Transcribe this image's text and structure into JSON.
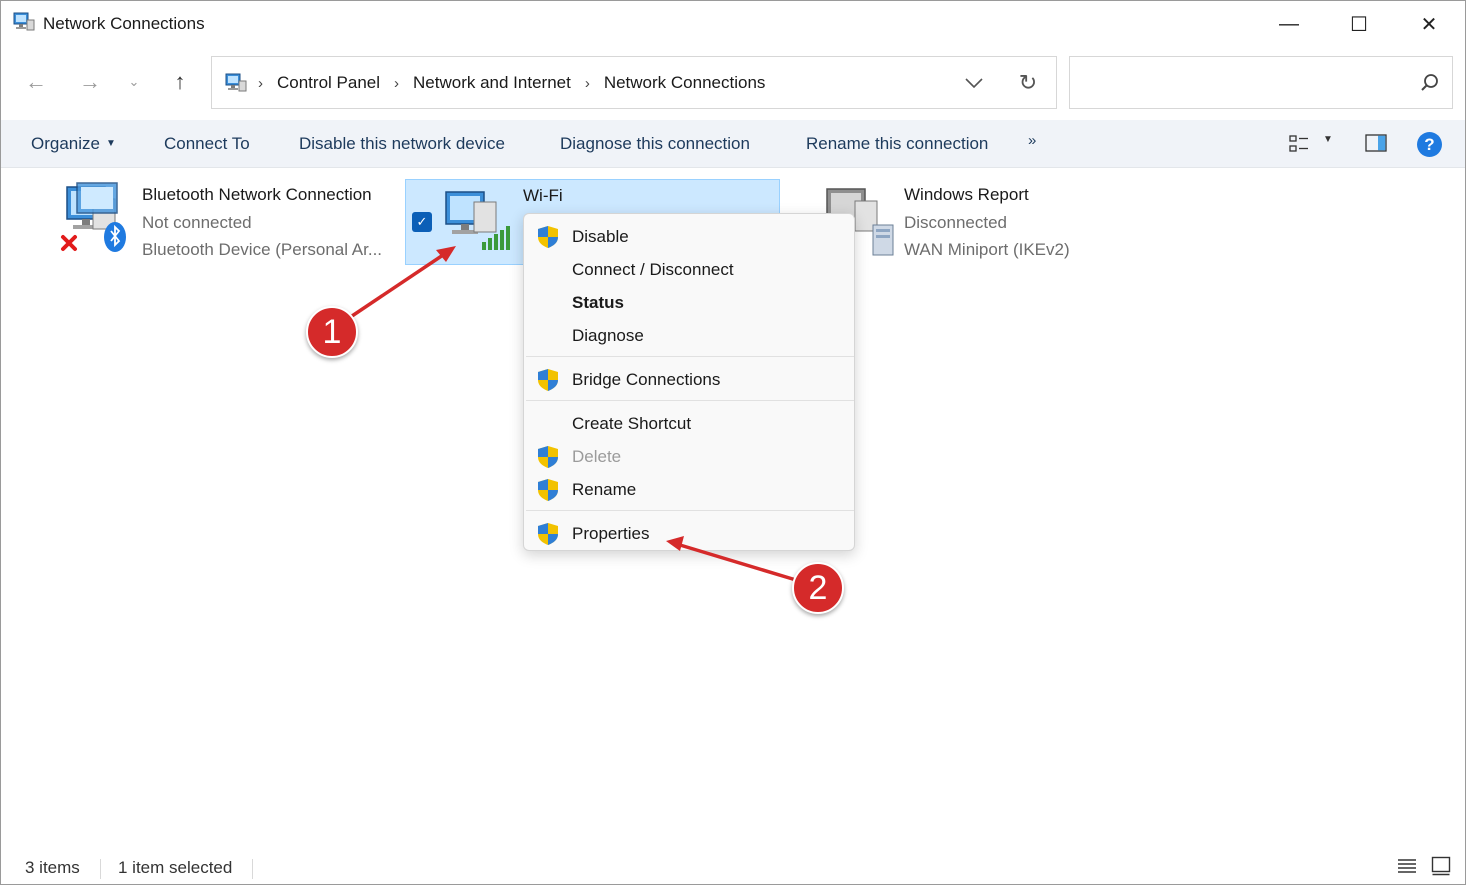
{
  "window": {
    "title": "Network Connections",
    "minimize": "—",
    "maximize": "☐",
    "close": "✕"
  },
  "nav": {
    "back": "←",
    "forward": "→",
    "recent": "⌄",
    "up": "↑"
  },
  "address": {
    "sep": "›",
    "crumbs": [
      "Control Panel",
      "Network and Internet",
      "Network Connections"
    ],
    "dropdown": "⌄",
    "refresh": "↻"
  },
  "search": {
    "placeholder": "",
    "value": ""
  },
  "commands": {
    "organize": "Organize",
    "connect_to": "Connect To",
    "disable": "Disable this network device",
    "diagnose": "Diagnose this connection",
    "rename": "Rename this connection",
    "more": "»",
    "help": "?"
  },
  "items": [
    {
      "name": "Bluetooth Network Connection",
      "status": "Not connected",
      "device": "Bluetooth Device (Personal Ar...",
      "icon": "bluetooth-network-icon",
      "selected": false
    },
    {
      "name": "Wi-Fi",
      "status": "",
      "device": "",
      "icon": "wifi-network-icon",
      "selected": true
    },
    {
      "name": "Windows Report",
      "status": "Disconnected",
      "device": "WAN Miniport (IKEv2)",
      "icon": "wan-network-icon",
      "selected": false
    }
  ],
  "context_menu": {
    "items": [
      {
        "label": "Disable",
        "shield": true
      },
      {
        "label": "Connect / Disconnect",
        "shield": false
      },
      {
        "label": "Status",
        "shield": false,
        "bold": true
      },
      {
        "label": "Diagnose",
        "shield": false
      },
      {
        "label": "Bridge Connections",
        "shield": true
      },
      {
        "label": "Create Shortcut",
        "shield": false
      },
      {
        "label": "Delete",
        "shield": true,
        "disabled": true
      },
      {
        "label": "Rename",
        "shield": true
      },
      {
        "label": "Properties",
        "shield": true
      }
    ]
  },
  "status_bar": {
    "item_count": "3 items",
    "selected": "1 item selected"
  },
  "annotations": {
    "badge_1": "1",
    "badge_2": "2",
    "color": "#d52a2a"
  },
  "colors": {
    "selection": "#cce8ff",
    "selection_border": "#99d1ff",
    "command_bar": "#f0f3f8",
    "help_blue": "#1f7ae0"
  }
}
